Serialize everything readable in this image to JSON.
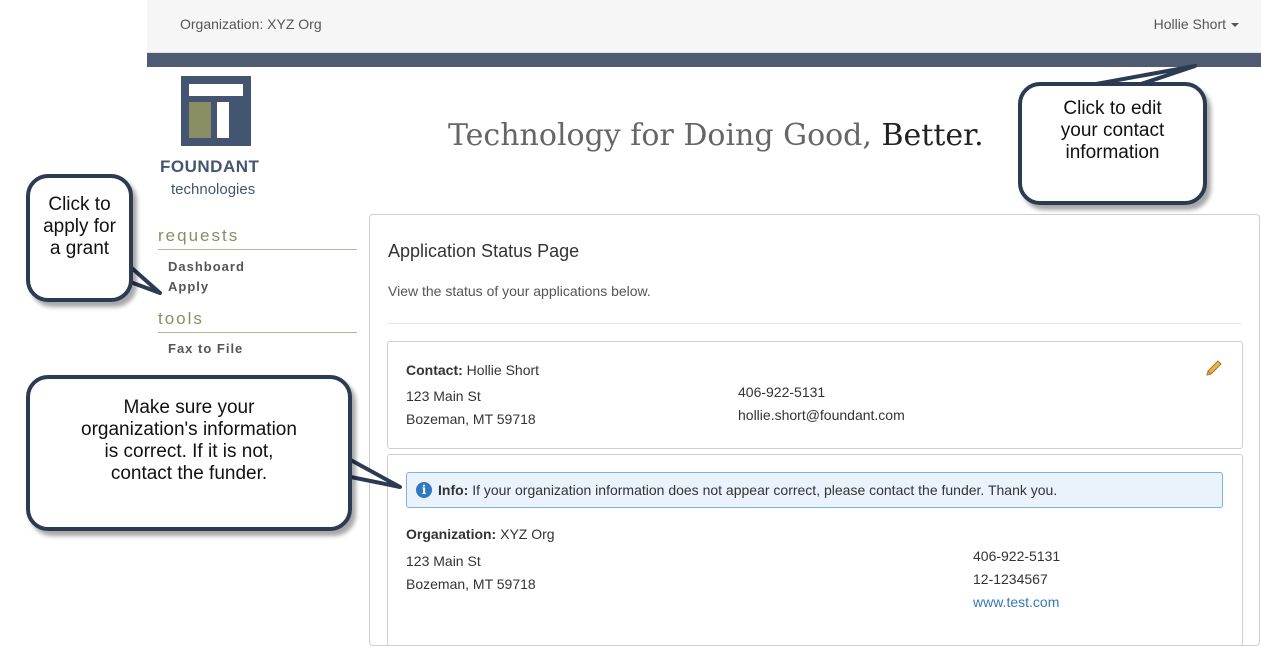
{
  "topbar": {
    "organization_label": "Organization: XYZ Org",
    "user_name": "Hollie Short"
  },
  "logo": {
    "word1": "FOUNDANT",
    "word2": "technologies"
  },
  "tagline": {
    "main": "Technology for Doing Good, ",
    "emphasis": "Better."
  },
  "sidebar": {
    "sections": [
      {
        "heading": "requests",
        "items": [
          "Dashboard",
          "Apply"
        ]
      },
      {
        "heading": "tools",
        "items": [
          "Fax to File"
        ]
      }
    ]
  },
  "main": {
    "title": "Application Status Page",
    "subtitle": "View the status of your applications below.",
    "contact": {
      "label": "Contact:",
      "name": "Hollie Short",
      "address1": "123 Main St",
      "address2": "Bozeman, MT 59718",
      "phone": "406-922-5131",
      "email": "hollie.short@foundant.com"
    },
    "info": {
      "label": "Info:",
      "message": "If your organization information does not appear correct, please contact the funder. Thank you."
    },
    "organization": {
      "label": "Organization:",
      "name": "XYZ Org",
      "address1": "123 Main St",
      "address2": "Bozeman, MT 59718",
      "phone": "406-922-5131",
      "tax_id": "12-1234567",
      "website": "www.test.com"
    }
  },
  "callouts": {
    "edit_contact": [
      "Click to edit",
      "your contact",
      "information"
    ],
    "apply": [
      "Click to",
      "apply for",
      "a grant"
    ],
    "org_info": [
      "Make sure your",
      "organization's information",
      "is correct.  If it is not,",
      "contact the funder."
    ]
  },
  "colors": {
    "brand_navy": "#4e5b73",
    "logo_green": "#8a8c63",
    "link_blue": "#337ab7",
    "info_blue": "#2f79c0"
  },
  "icons": [
    "caret-down-icon",
    "logo-icon",
    "pencil-icon",
    "info-icon"
  ]
}
